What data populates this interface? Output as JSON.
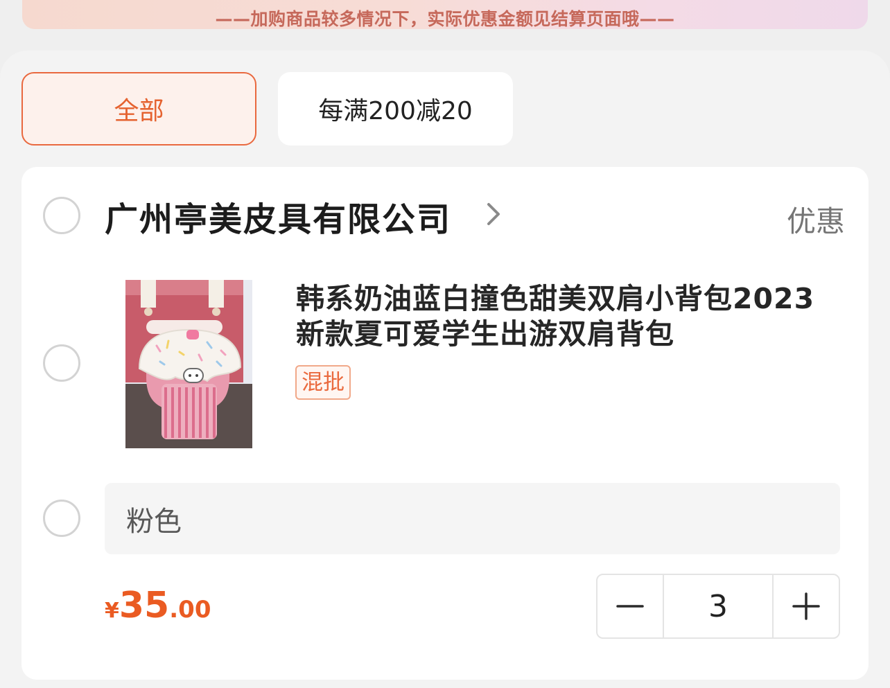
{
  "banner": {
    "notice": "——加购商品较多情况下，实际优惠金额见结算页面哦——"
  },
  "tabs": [
    {
      "label": "全部",
      "active": true
    },
    {
      "label": "每满200减20",
      "active": false
    }
  ],
  "shop": {
    "name": "广州亭美皮具有限公司",
    "discount_label": "优惠"
  },
  "product": {
    "title": "韩系奶油蓝白撞色甜美双肩小背包2023新款夏可爱学生出游双肩背包",
    "tag": "混批",
    "sku": "粉色",
    "price": {
      "currency": "¥",
      "integer": "35",
      "decimal": ".00"
    },
    "quantity": "3"
  },
  "colors": {
    "accent": "#e5622f",
    "background": "#efefef"
  },
  "icons": {
    "chevron": "chevron-right-icon",
    "minus": "minus-icon",
    "plus": "plus-icon"
  }
}
